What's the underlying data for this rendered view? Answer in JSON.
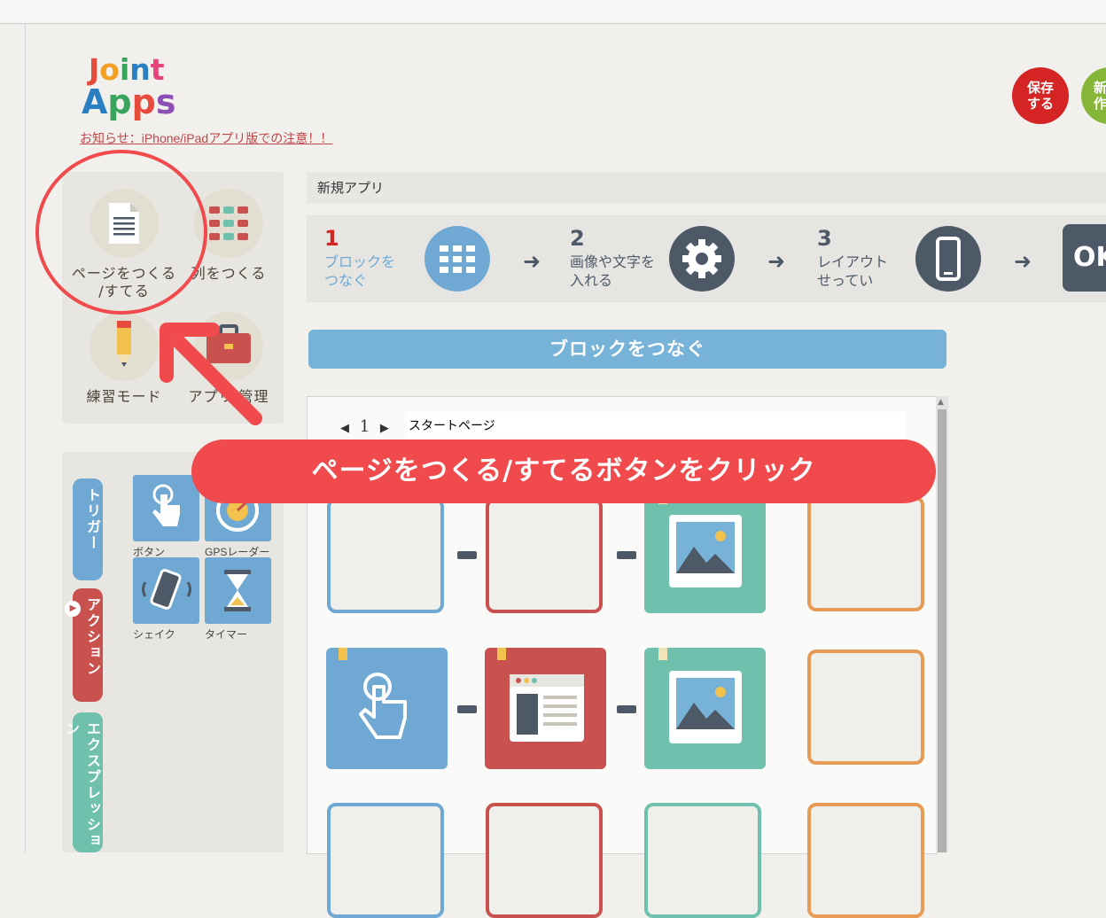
{
  "notice": "お知らせ：iPhone/iPadアプリ版での注意！！",
  "header": {
    "save_label": "保存\nする",
    "new_label": "新\n作"
  },
  "menu": {
    "items": [
      {
        "label": "ページをつくる\n/すてる"
      },
      {
        "label": "列をつくる"
      },
      {
        "label": "練習モード"
      },
      {
        "label": "アプリ  管理"
      }
    ]
  },
  "side_tabs": {
    "trigger": "トリガー",
    "action": "アクション",
    "expression": "エクスプレッション"
  },
  "blocks": [
    {
      "label": "ボタン"
    },
    {
      "label": "GPSレーダー"
    },
    {
      "label": "シェイク"
    },
    {
      "label": "タイマー"
    }
  ],
  "app_title": "新規アプリ",
  "steps": [
    {
      "num": "1",
      "text": "ブロックを\nつなぐ"
    },
    {
      "num": "2",
      "text": "画像や文字を\n入れる"
    },
    {
      "num": "3",
      "text": "レイアウト\nせってい"
    },
    {
      "final": "OK"
    }
  ],
  "section_button": "ブロックをつなぐ",
  "pager": {
    "prev": "◀",
    "page": "1",
    "next": "▶",
    "page_name": "スタートページ"
  },
  "callout": "ページをつくる/すてるボタンをクリック",
  "colors": {
    "accent_red": "#f04a4c",
    "blue": "#6fa9d3",
    "green": "#6fc1ae",
    "red_block": "#c9524e",
    "orange": "#e79b55"
  }
}
